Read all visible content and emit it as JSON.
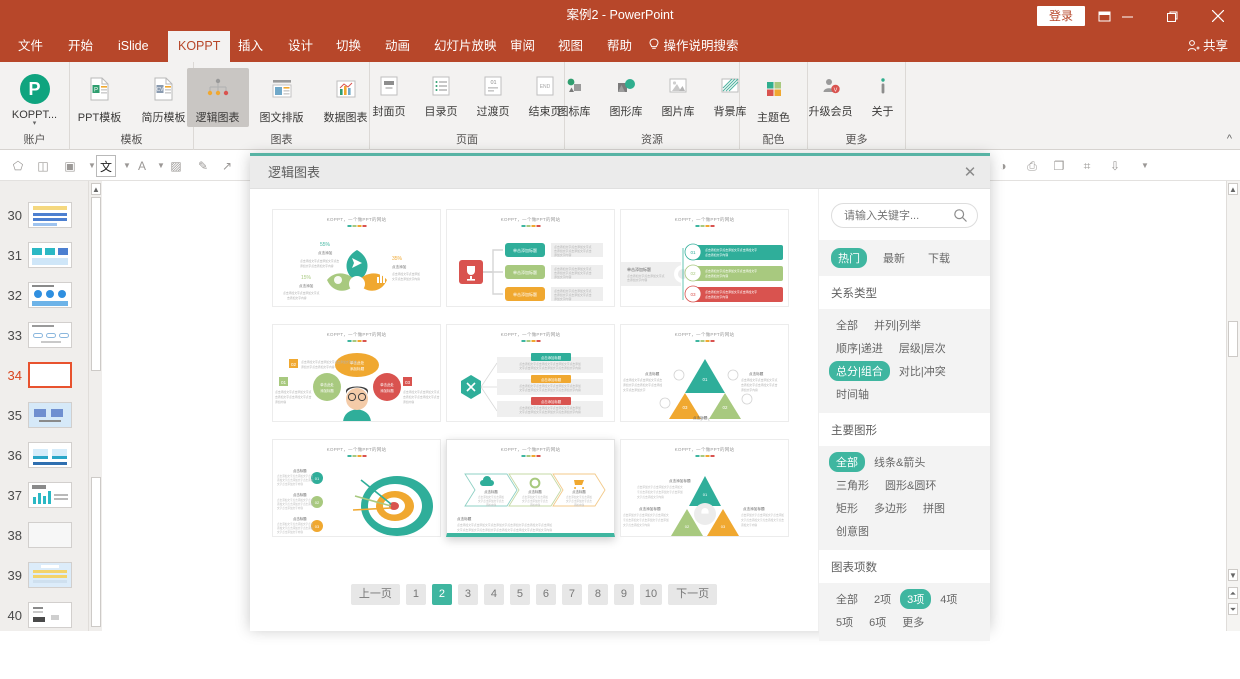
{
  "titlebar": {
    "doc_title": "案例2  -  PowerPoint",
    "signin_label": "登录",
    "ribbon_display_options": "ribbon-display-options-icon",
    "minimize": "minimize-icon",
    "restore": "restore-icon",
    "close": "close-icon",
    "share_label": "共享"
  },
  "tabs": [
    {
      "label": "文件",
      "active": false
    },
    {
      "label": "开始",
      "active": false
    },
    {
      "label": "iSlide",
      "active": false
    },
    {
      "label": "KOPPT",
      "active": true
    },
    {
      "label": "插入",
      "active": false
    },
    {
      "label": "设计",
      "active": false
    },
    {
      "label": "切换",
      "active": false
    },
    {
      "label": "动画",
      "active": false
    },
    {
      "label": "幻灯片放映",
      "active": false
    },
    {
      "label": "审阅",
      "active": false
    },
    {
      "label": "视图",
      "active": false
    },
    {
      "label": "帮助",
      "active": false
    }
  ],
  "help_search": "操作说明搜索",
  "ribbon": {
    "groups": [
      {
        "name": "账户",
        "items": [
          {
            "label": "KOPPT...",
            "icon": "koppt-logo-icon",
            "active": false
          }
        ]
      },
      {
        "name": "模板",
        "items": [
          {
            "label": "PPT模板",
            "icon": "ppt-template-icon",
            "active": false
          },
          {
            "label": "简历模板",
            "icon": "resume-template-icon",
            "active": false
          }
        ]
      },
      {
        "name": "图表",
        "items": [
          {
            "label": "逻辑图表",
            "icon": "logic-chart-icon",
            "active": true
          },
          {
            "label": "图文排版",
            "icon": "text-image-layout-icon",
            "active": false
          },
          {
            "label": "数据图表",
            "icon": "data-chart-icon",
            "active": false
          }
        ]
      },
      {
        "name": "页面",
        "items": [
          {
            "label": "封面页",
            "icon": "cover-page-icon",
            "active": false
          },
          {
            "label": "目录页",
            "icon": "toc-page-icon",
            "active": false
          },
          {
            "label": "过渡页",
            "icon": "transition-page-icon",
            "active": false
          },
          {
            "label": "结束页",
            "icon": "end-page-icon",
            "active": false
          }
        ]
      },
      {
        "name": "资源",
        "items": [
          {
            "label": "图标库",
            "icon": "icon-library-icon",
            "active": false
          },
          {
            "label": "图形库",
            "icon": "shape-library-icon",
            "active": false
          },
          {
            "label": "图片库",
            "icon": "image-library-icon",
            "active": false
          },
          {
            "label": "背景库",
            "icon": "background-library-icon",
            "active": false
          }
        ]
      },
      {
        "name": "配色",
        "items": [
          {
            "label": "主题色",
            "icon": "theme-color-icon",
            "active": false
          }
        ]
      },
      {
        "name": "更多",
        "items": [
          {
            "label": "升级会员",
            "icon": "upgrade-member-icon",
            "active": false
          },
          {
            "label": "关于",
            "icon": "about-info-icon",
            "active": false
          }
        ]
      }
    ],
    "collapse_icon": "chevron-up-icon"
  },
  "format_toolbar": [
    "shape-icon",
    "align-icon",
    "text-box-icon",
    "caret-down-icon",
    "chinese-text-icon",
    "caret-down-icon-2",
    "font-color-icon",
    "caret-down-icon-3",
    "shape-fill-icon",
    "eyedropper-icon",
    "arrow-icon",
    "speaker-icon",
    "print-icon",
    "lock-icon",
    "layers-icon",
    "crop-icon",
    "export-icon",
    "more-icon"
  ],
  "slide_panel": {
    "slides": [
      {
        "number": "30",
        "current": false,
        "kind": "bullets"
      },
      {
        "number": "31",
        "current": false,
        "kind": "threebar"
      },
      {
        "number": "32",
        "current": false,
        "kind": "circles"
      },
      {
        "number": "33",
        "current": false,
        "kind": "pills"
      },
      {
        "number": "34",
        "current": true,
        "kind": "blank"
      },
      {
        "number": "35",
        "current": false,
        "kind": "twobox"
      },
      {
        "number": "36",
        "current": false,
        "kind": "ushape"
      },
      {
        "number": "37",
        "current": false,
        "kind": "chart"
      },
      {
        "number": "38",
        "current": false,
        "kind": "empty"
      },
      {
        "number": "39",
        "current": false,
        "kind": "table"
      },
      {
        "number": "40",
        "current": false,
        "kind": "textlist"
      }
    ]
  },
  "dialog": {
    "title": "逻辑图表",
    "close_icon": "close-icon",
    "search": {
      "placeholder": "请输入关键字...",
      "value": "",
      "icon": "search-icon"
    },
    "sort_tabs": [
      {
        "label": "热门",
        "active": true
      },
      {
        "label": "最新",
        "active": false
      },
      {
        "label": "下载",
        "active": false
      }
    ],
    "filter_sections": [
      {
        "title": "关系类型",
        "options": [
          {
            "label": "全部",
            "active": false
          },
          {
            "label": "并列|列举",
            "active": false
          },
          {
            "label": "顺序|递进",
            "active": false
          },
          {
            "label": "层级|层次",
            "active": false
          },
          {
            "label": "总分|组合",
            "active": true
          },
          {
            "label": "对比|冲突",
            "active": false
          },
          {
            "label": "时间轴",
            "active": false
          }
        ]
      },
      {
        "title": "主要图形",
        "options": [
          {
            "label": "全部",
            "active": true
          },
          {
            "label": "线条&箭头",
            "active": false
          },
          {
            "label": "三角形",
            "active": false
          },
          {
            "label": "圆形&圆环",
            "active": false
          },
          {
            "label": "矩形",
            "active": false
          },
          {
            "label": "多边形",
            "active": false
          },
          {
            "label": "拼图",
            "active": false
          },
          {
            "label": "创意图",
            "active": false
          }
        ]
      },
      {
        "title": "图表项数",
        "options": [
          {
            "label": "全部",
            "active": false
          },
          {
            "label": "2项",
            "active": false
          },
          {
            "label": "3项",
            "active": true
          },
          {
            "label": "4项",
            "active": false
          },
          {
            "label": "5项",
            "active": false
          },
          {
            "label": "6项",
            "active": false
          },
          {
            "label": "更多",
            "active": false
          }
        ]
      }
    ],
    "gallery": {
      "card_title": "KOPPT，一个做PPT的网站",
      "cards": [
        {
          "name": "three-petal-flower-diagram",
          "selected": false
        },
        {
          "name": "trophy-three-branch-diagram",
          "selected": false
        },
        {
          "name": "numbered-bars-diagram",
          "selected": false
        },
        {
          "name": "person-three-bubbles-diagram",
          "selected": false
        },
        {
          "name": "hexagon-three-boxes-diagram",
          "selected": false
        },
        {
          "name": "triangle-three-gears-diagram",
          "selected": false
        },
        {
          "name": "target-arrows-diagram",
          "selected": false
        },
        {
          "name": "three-chevron-process-diagram",
          "selected": true
        },
        {
          "name": "triangle-three-parts-diagram",
          "selected": false
        }
      ]
    },
    "pagination": {
      "prev_label": "上一页",
      "next_label": "下一页",
      "pages": [
        "1",
        "2",
        "3",
        "4",
        "5",
        "6",
        "7",
        "8",
        "9",
        "10"
      ],
      "current": "2"
    }
  },
  "colors": {
    "brand_red": "#b7472a",
    "teal": "#3fb6a0",
    "green": "#a8c97f",
    "orange": "#f0a830",
    "red": "#d9534f",
    "select_orange": "#e8522e"
  }
}
